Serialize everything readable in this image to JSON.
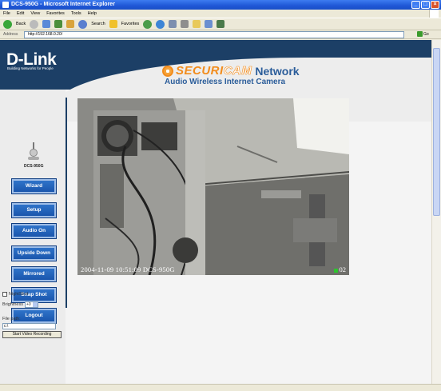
{
  "window": {
    "title": "DCS-950G - Microsoft Internet Explorer"
  },
  "menu": [
    "File",
    "Edit",
    "View",
    "Favorites",
    "Tools",
    "Help"
  ],
  "toolbar": {
    "back_label": "Back",
    "search_label": "Search",
    "favorites_label": "Favorites"
  },
  "address": {
    "label": "Address",
    "url": "http://192.168.0.20/",
    "go_label": "Go"
  },
  "header": {
    "logo_text": "D-Link",
    "logo_tagline": "Building Networks for People",
    "brand_securi": "SECURI",
    "brand_cam": "CAM",
    "brand_network": "Network",
    "subtitle": "Audio Wireless Internet Camera"
  },
  "sidebar": {
    "model": "DCS-950G",
    "buttons": [
      "Wizard",
      "Setup",
      "Audio On",
      "Upside Down",
      "Mirrored",
      "Snap Shot",
      "Logout"
    ],
    "nightshot_label": "NightShot",
    "brightness_label": "Brightness",
    "brightness_value": "+0",
    "filepath_label": "File path:",
    "filepath_value": "c:\\",
    "record_button": "Start Video Recording"
  },
  "camera": {
    "osd_timestamp": "2004-11-09 10:51:09 DCS-950G",
    "osd_right": "02"
  },
  "colors": {
    "header_navy": "#1c3f66",
    "brand_orange": "#f28c1c",
    "brand_blue": "#2b5d9a",
    "nav_button": "#2f73c9"
  }
}
